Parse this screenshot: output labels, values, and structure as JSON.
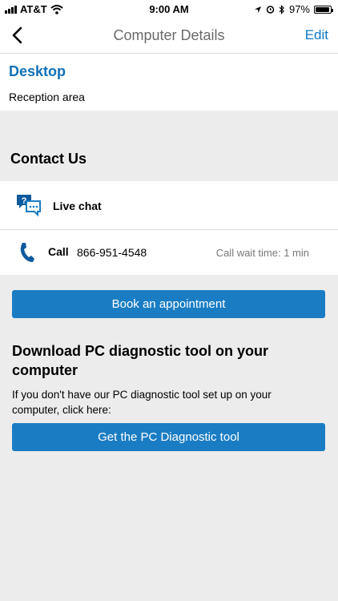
{
  "status_bar": {
    "carrier": "AT&T",
    "time": "9:00 AM",
    "battery": "97%",
    "battery_level": 0.97
  },
  "nav": {
    "title": "Computer Details",
    "edit_label": "Edit"
  },
  "device": {
    "name": "Desktop",
    "location": "Reception area"
  },
  "contact": {
    "title": "Contact Us",
    "chat_label": "Live chat",
    "call_label": "Call",
    "call_number": "866-951-4548",
    "call_wait": "Call wait time: 1 min"
  },
  "book_button": "Book an appointment",
  "download": {
    "title": "Download PC diagnostic tool on your computer",
    "description": "If you don't have our PC diagnostic tool set up on your computer, click here:",
    "button_label": "Get the PC Diagnostic tool"
  },
  "colors": {
    "accent": "#1a7dc4",
    "link": "#0a78c8",
    "background": "#ececec"
  }
}
